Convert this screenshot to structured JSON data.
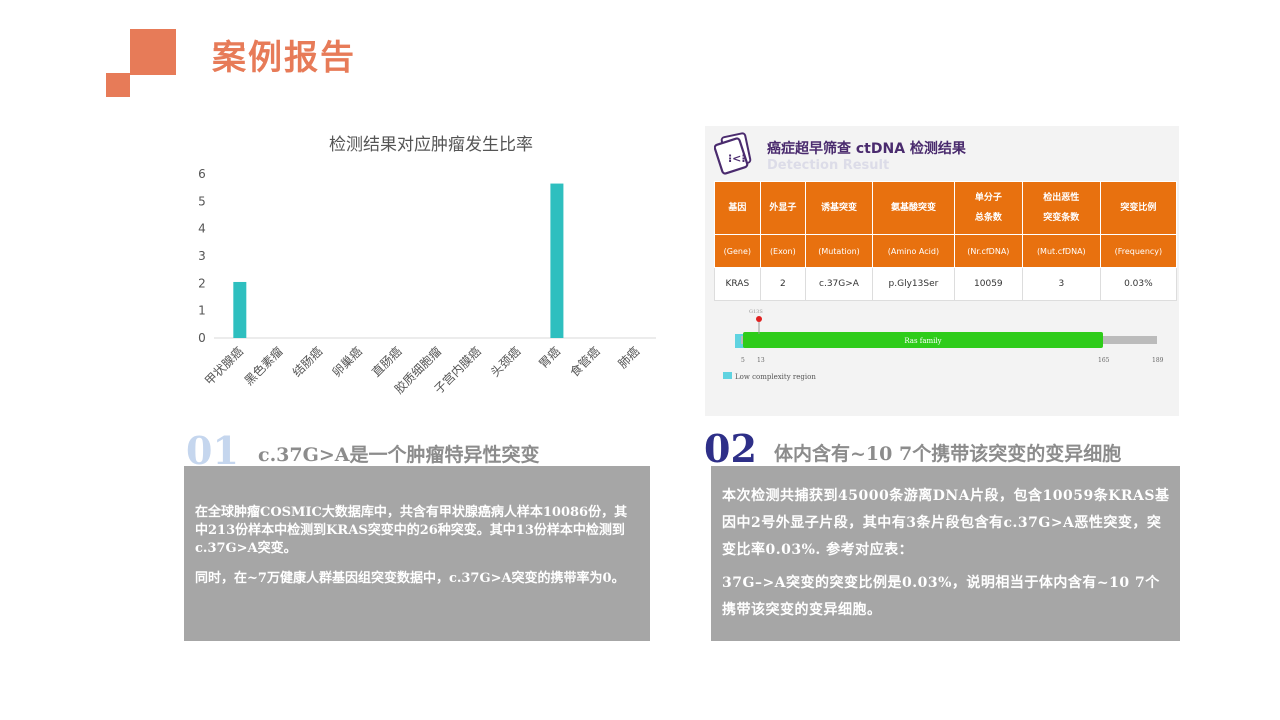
{
  "page": {
    "title": "案例报告",
    "accent_color": "#e77b58"
  },
  "chart_data": {
    "type": "bar",
    "title": "检测结果对应肿瘤发生比率",
    "categories": [
      "甲状腺癌",
      "黑色素瘤",
      "结肠癌",
      "卵巢癌",
      "直肠癌",
      "胶质细胞瘤",
      "子宫内膜癌",
      "头颈癌",
      "胃癌",
      "食管癌",
      "肺癌"
    ],
    "values": [
      2.05,
      0,
      0,
      0,
      0,
      0,
      0,
      0,
      5.65,
      0,
      0
    ],
    "ylim": [
      0,
      6
    ],
    "yticks": [
      "0",
      "1",
      "2",
      "3",
      "4",
      "5",
      "6"
    ],
    "bar_color": "#2ebfbf",
    "grid": false,
    "legend": "none"
  },
  "report": {
    "title": "癌症超早筛查 ctDNA 检测结果",
    "subtitle": "Detection Result",
    "header_color": "#e8710f",
    "columns": [
      {
        "cn": "基因",
        "cn2": "",
        "en": "(Gene)"
      },
      {
        "cn": "外显子",
        "cn2": "",
        "en": "(Exon)"
      },
      {
        "cn": "诱基突变",
        "cn2": "",
        "en": "(Mutation)"
      },
      {
        "cn": "氨基酸突变",
        "cn2": "",
        "en": "(Amino Acid)"
      },
      {
        "cn": "单分子",
        "cn2": "总条数",
        "en": "(Nr.cfDNA)"
      },
      {
        "cn": "检出恶性",
        "cn2": "突变条数",
        "en": "(Mut.cfDNA)"
      },
      {
        "cn": "突变比例",
        "cn2": "",
        "en": "(Frequency)"
      }
    ],
    "row": [
      "KRAS",
      "2",
      "c.37G>A",
      "p.Gly13Ser",
      "10059",
      "3",
      "0.03%"
    ],
    "domain": {
      "label": "Ras family",
      "marker_label": "G13S",
      "axis_labels": [
        "5",
        "13",
        "165",
        "189"
      ],
      "legend": "Low complexity region",
      "domain_color": "#2ecc1a",
      "lcr_color": "#5fd3e0"
    }
  },
  "sections": [
    {
      "number": "01",
      "heading": "c.37G>A是一个肿瘤特异性突变",
      "paragraphs": [
        "在全球肿瘤COSMIC大数据库中，共含有甲状腺癌病人样本10086份，其中213份样本中检测到KRAS突变中的26种突变。其中13份样本中检测到c.37G>A突变。",
        "同时，在~7万健康人群基因组突变数据中，c.37G>A突变的携带率为0。"
      ]
    },
    {
      "number": "02",
      "heading": "体内含有~10 7个携带该突变的变异细胞",
      "paragraphs": [
        "本次检测共捕获到45000条游离DNA片段，包含10059条KRAS基因中2号外显子片段，其中有3条片段包含有c.37G>A恶性突变，突变比率0.03%. 参考对应表：",
        "37G–>A突变的突变比例是0.03%，说明相当于体内含有~10 7个携带该突变的变异细胞。"
      ]
    }
  ]
}
